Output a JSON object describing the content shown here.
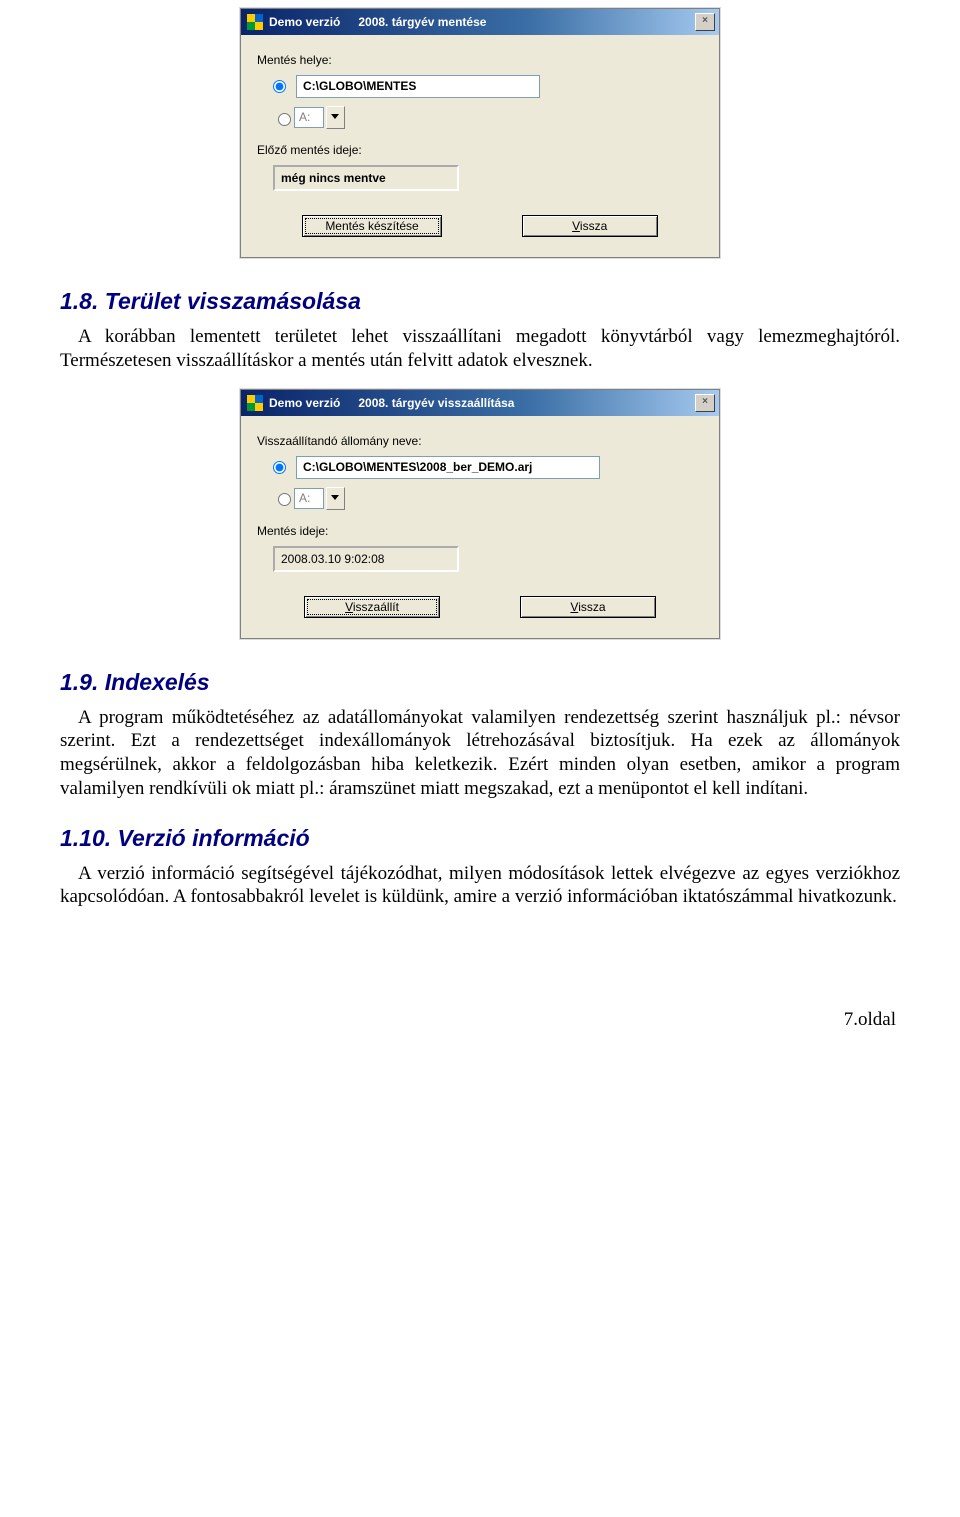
{
  "dialog1": {
    "title_left": "Demo verzió",
    "title_right": "2008. tárgyév mentése",
    "loc_label": "Mentés helye:",
    "path": "C:\\GLOBO\\MENTES",
    "drive": "A:",
    "prev_label": "Előző mentés ideje:",
    "prev_value": "még nincs mentve",
    "btn_primary": "Mentés készítése",
    "btn_back_u": "V",
    "btn_back_rest": "issza"
  },
  "section18": {
    "heading": "1.8.  Terület visszamásolása",
    "para": "A korábban lementett területet lehet visszaállítani megadott könyvtárból vagy lemezmeghajtóról. Természetesen visszaállításkor a mentés után felvitt adatok elvesznek."
  },
  "dialog2": {
    "title_left": "Demo verzió",
    "title_right": "2008. tárgyév visszaállítása",
    "loc_label": "Visszaállítandó állomány neve:",
    "path": "C:\\GLOBO\\MENTES\\2008_ber_DEMO.arj",
    "drive": "A:",
    "prev_label": "Mentés ideje:",
    "prev_value": "2008.03.10 9:02:08",
    "btn_primary_u": "V",
    "btn_primary_rest": "isszaállít",
    "btn_back_u": "V",
    "btn_back_rest": "issza"
  },
  "section19": {
    "heading": "1.9.  Indexelés",
    "para": "A program működtetéséhez az adatállományokat valamilyen rendezettség szerint használjuk pl.: névsor szerint. Ezt a rendezettséget indexállományok létrehozásával biztosítjuk. Ha ezek az állományok megsérülnek, akkor a feldolgozásban hiba keletkezik. Ezért minden olyan esetben, amikor a program valamilyen rendkívüli ok miatt pl.: áramszünet miatt megszakad, ezt a menüpontot el kell indítani."
  },
  "section110": {
    "heading": "1.10.  Verzió információ",
    "para": "A verzió információ segítségével tájékozódhat, milyen módosítások lettek elvégezve az egyes verziókhoz kapcsolódóan. A fontosabbakról levelet is küldünk, amire a verzió információban iktatószámmal hivatkozunk."
  },
  "footer": "7.oldal"
}
